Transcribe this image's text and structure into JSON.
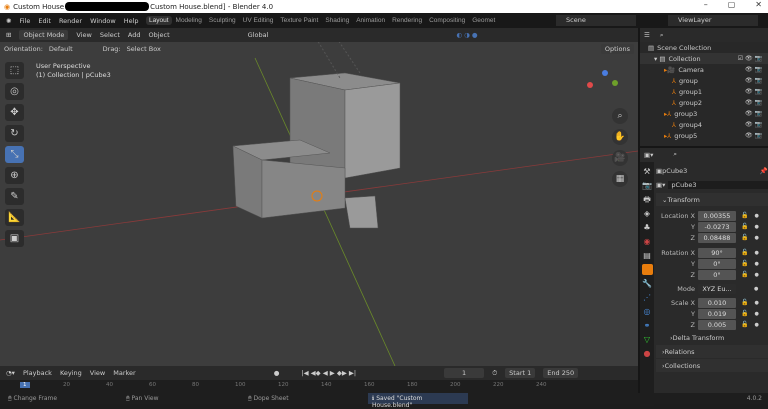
{
  "window": {
    "title_prefix": "Custom House",
    "title_suffix": "Custom House.blend] - Blender 4.0",
    "minimize": "–",
    "maximize": "▢",
    "close": "✕"
  },
  "menu": [
    "File",
    "Edit",
    "Render",
    "Window",
    "Help"
  ],
  "workspaces": [
    "Layout",
    "Modeling",
    "Sculpting",
    "UV Editing",
    "Texture Paint",
    "Shading",
    "Animation",
    "Rendering",
    "Compositing",
    "Geomet"
  ],
  "scene": "Scene",
  "view_layer": "ViewLayer",
  "viewport_header": {
    "mode": "Object Mode",
    "menus": [
      "View",
      "Select",
      "Add",
      "Object"
    ],
    "transform": "Global"
  },
  "orientation": {
    "label": "Orientation:",
    "value": "Default",
    "drag_label": "Drag:",
    "drag_value": "Select Box",
    "options": "Options"
  },
  "overlay": {
    "view": "User Perspective",
    "context": "(1) Collection | pCube3"
  },
  "outliner": {
    "root": "Scene Collection",
    "collection": "Collection",
    "items": [
      "Camera",
      "group",
      "group1",
      "group2",
      "group3",
      "group4",
      "group5"
    ]
  },
  "properties": {
    "object_name": "pCube3",
    "data_name": "pCube3",
    "transform": "Transform",
    "location": {
      "label": "Location X",
      "x": "0.00355",
      "y": "-0.0273",
      "z": "0.08488"
    },
    "rotation": {
      "label": "Rotation X",
      "x": "90°",
      "y": "0°",
      "z": "0°"
    },
    "mode_label": "Mode",
    "mode": "XYZ Eu...",
    "scale": {
      "label": "Scale X",
      "x": "0.010",
      "y": "0.019",
      "z": "0.005"
    },
    "axis_y": "Y",
    "axis_z": "Z",
    "delta": "Delta Transform",
    "relations": "Relations",
    "collections": "Collections"
  },
  "timeline": {
    "menus": [
      "Playback",
      "Keying",
      "View",
      "Marker"
    ],
    "frame": "1",
    "start_label": "Start",
    "start": "1",
    "end_label": "End",
    "end": "250",
    "ticks": [
      "1",
      "20",
      "40",
      "60",
      "80",
      "100",
      "120",
      "140",
      "160",
      "180",
      "200",
      "220",
      "240"
    ]
  },
  "status": {
    "change_frame": "Change Frame",
    "pan_view": "Pan View",
    "dope_sheet": "Dope Sheet",
    "saved": "Saved \"Custom House.blend\"",
    "version": "4.0.2"
  }
}
